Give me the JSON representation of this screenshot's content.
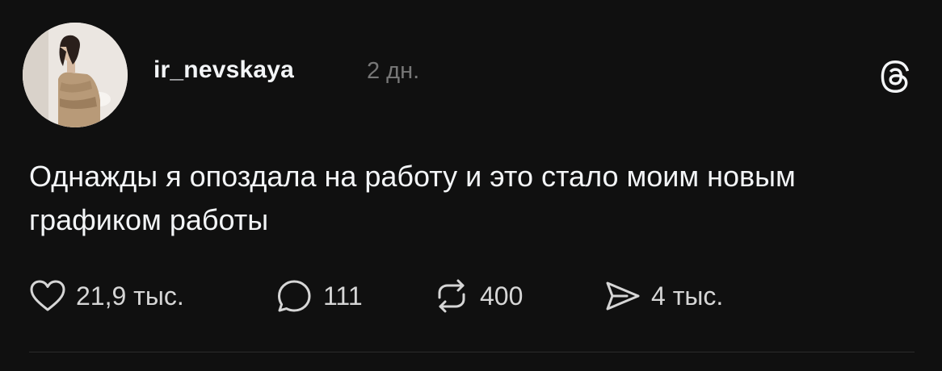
{
  "post": {
    "username": "ir_nevskaya",
    "timestamp": "2 дн.",
    "text": "Однажды я опоздала на работу и это стало моим новым графиком работы",
    "app_logo_icon": "threads-logo-icon",
    "avatar_icon": "user-avatar-photo"
  },
  "actions": {
    "likes": "21,9 тыс.",
    "comments": "111",
    "reposts": "400",
    "shares": "4 тыс."
  },
  "colors": {
    "background": "#101010",
    "text": "#f3f5f7",
    "muted": "#777777"
  }
}
